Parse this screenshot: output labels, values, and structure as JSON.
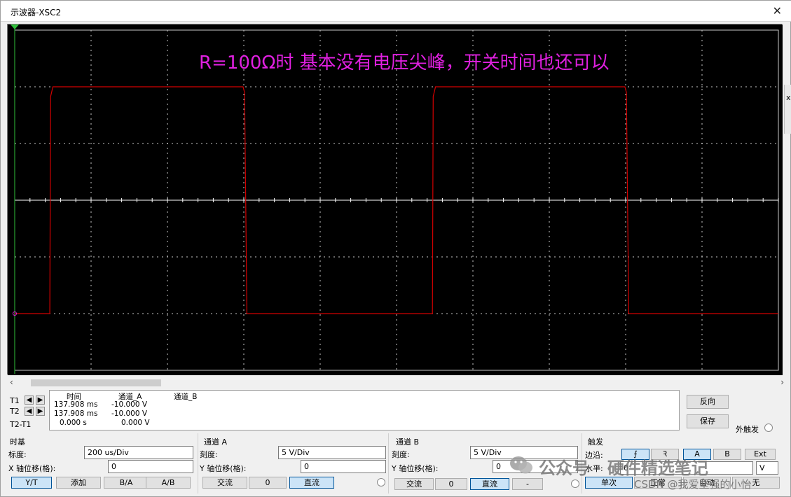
{
  "window": {
    "title": "示波器-XSC2",
    "close_glyph": "✕"
  },
  "screen": {
    "annotation": "R=100Ω时 基本没有电压尖峰，开关时间也还可以",
    "colors": {
      "background": "#000000",
      "grid": "#c8c8c8",
      "trace_a": "#d40000",
      "annotation": "#e020e0"
    }
  },
  "right_edge_label": "x",
  "cursor_panel": {
    "rows": [
      "T1",
      "T2",
      "T2-T1"
    ],
    "headers": {
      "time": "时间",
      "channel_a": "通道_A",
      "channel_b": "通道_B"
    },
    "t1": {
      "time": "137.908 ms",
      "channel_a": "-10.000 V",
      "channel_b": ""
    },
    "t2": {
      "time": "137.908 ms",
      "channel_a": "-10.000 V",
      "channel_b": ""
    },
    "diff": {
      "time": "0.000 s",
      "channel_a": "0.000 V",
      "channel_b": ""
    },
    "left_arrow": "◆",
    "right_arrow": "➔"
  },
  "side_buttons": {
    "reverse": "反向",
    "save": "保存",
    "ext_trigger": "外触发"
  },
  "timebase": {
    "title": "时基",
    "scale_label": "标度:",
    "scale_value": "200 us/Div",
    "xpos_label": "X 轴位移(格):",
    "xpos_value": "0",
    "modes": [
      "Y/T",
      "添加",
      "B/A",
      "A/B"
    ],
    "active_mode": "Y/T"
  },
  "channel_a": {
    "title": "通道 A",
    "scale_label": "刻度:",
    "scale_value": "5  V/Div",
    "ypos_label": "Y 轴位移(格):",
    "ypos_value": "0",
    "coupling": [
      "交流",
      "0",
      "直流"
    ],
    "active_coupling": "直流"
  },
  "channel_b": {
    "title": "通道 B",
    "scale_label": "刻度:",
    "scale_value": "5  V/Div",
    "ypos_label": "Y 轴位移(格):",
    "ypos_value": "0",
    "coupling": [
      "交流",
      "0",
      "直流",
      "-"
    ],
    "active_coupling": "直流"
  },
  "trigger": {
    "title": "触发",
    "edge_label": "边沿:",
    "edge_rising": "⨍",
    "edge_falling": "Ꝛ",
    "sources": [
      "A",
      "B",
      "Ext"
    ],
    "active_source": "A",
    "level_label": "水平:",
    "level_value": "0",
    "level_unit": "V",
    "modes": [
      "单次",
      "正常",
      "自动",
      "无"
    ]
  },
  "watermark": {
    "main": "公众号 · 硬件精选笔记",
    "sub": "CSDN @我爱坚强的小怡"
  }
}
